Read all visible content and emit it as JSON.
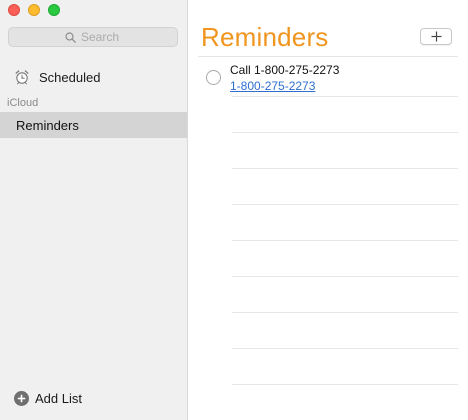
{
  "window": {
    "traffic_lights": [
      "close",
      "minimize",
      "zoom"
    ]
  },
  "sidebar": {
    "search": {
      "placeholder": "Search"
    },
    "smart_lists": [
      {
        "label": "Scheduled",
        "icon": "alarm-clock-icon"
      }
    ],
    "section_label": "iCloud",
    "lists": [
      {
        "label": "Reminders",
        "selected": true
      }
    ],
    "add_list_label": "Add List"
  },
  "main": {
    "title": "Reminders",
    "add_button_icon": "plus-icon",
    "reminders": [
      {
        "title": "Call 1-800-275-2273",
        "note_link": "1-800-275-2273",
        "completed": false
      }
    ]
  },
  "colors": {
    "accent": "#f0951e",
    "link": "#2e6fd1",
    "selection": "#d4d4d4",
    "sidebar_bg": "#f0f0f0"
  }
}
